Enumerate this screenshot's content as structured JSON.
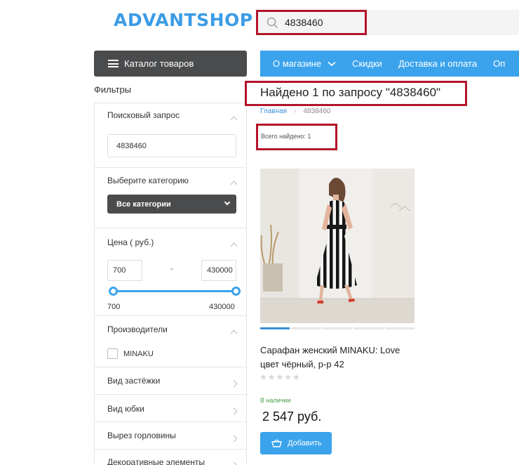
{
  "header": {
    "logo": "ADVANTSHOP",
    "search": {
      "value": "4838460",
      "icon": "search-icon"
    }
  },
  "catalog_button": {
    "label": "Каталог товаров",
    "icon": "menu-icon"
  },
  "main_menu": [
    {
      "label": "О магазине",
      "has_dropdown": true
    },
    {
      "label": "Скидки"
    },
    {
      "label": "Доставка и оплата"
    },
    {
      "label": "Оп"
    }
  ],
  "filters": {
    "title": "Фильтры",
    "query": {
      "label": "Поисковый запрос",
      "value": "4838460"
    },
    "category": {
      "label": "Выберите категорию",
      "selected": "Все категории"
    },
    "price": {
      "label": "Цена ( руб.)",
      "from": "700",
      "to": "430000",
      "dash": "-",
      "min_label": "700",
      "max_label": "430000"
    },
    "brands": {
      "label": "Производители",
      "options": [
        "MINAKU"
      ]
    },
    "collapsed": [
      "Вид застёжки",
      "Вид юбки",
      "Вырез горловины",
      "Декоративные элементы"
    ]
  },
  "results": {
    "title": "Найдено 1 по запросу \"4838460\"",
    "breadcrumb": {
      "home": "Главная",
      "current": "4838460"
    },
    "total": "Всего найдено: 1"
  },
  "product": {
    "name": "Сарафан женский MINAKU: Love цвет чёрный, р-р 42",
    "rating": "★★★★★",
    "availability": "В наличии",
    "price": "2 547 руб.",
    "buy_label": "Добавить",
    "image_count": 5,
    "active_image": 0
  },
  "colors": {
    "brand_blue": "#3aa3ec",
    "highlight": "#b3142a",
    "dark": "#4a4b4d",
    "in_stock": "#4aa04a"
  }
}
